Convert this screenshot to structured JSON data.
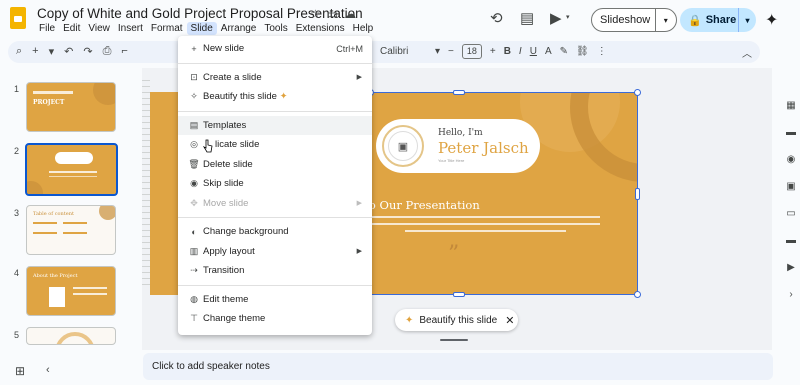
{
  "app": {
    "title": "Copy of White and Gold Project Proposal Presentation",
    "menus": [
      "File",
      "Edit",
      "View",
      "Insert",
      "Format",
      "Slide",
      "Arrange",
      "Tools",
      "Extensions",
      "Help"
    ],
    "active_menu": "Slide",
    "slideshow_label": "Slideshow",
    "share_label": "Share"
  },
  "toolbar": {
    "font": "Calibri",
    "font_size": "18"
  },
  "filmstrip": {
    "slides": [
      {
        "num": "1",
        "text": "PROJECT"
      },
      {
        "num": "2",
        "text": ""
      },
      {
        "num": "3",
        "text": "Table of content"
      },
      {
        "num": "4",
        "text": "About the Project"
      },
      {
        "num": "5",
        "text": ""
      }
    ]
  },
  "slide": {
    "hello": "Hello, I'm",
    "name": "Peter Jalsch",
    "subtitle": "Your Title Here",
    "welcome": "Welcome to Our Presentation",
    "quote_mark": "”"
  },
  "slide_menu": {
    "items": [
      {
        "label": "New slide",
        "shortcut": "Ctrl+M",
        "icon": "plus-icon"
      },
      {
        "label": "Create a slide",
        "submenu": true,
        "icon": "create-slide-icon"
      },
      {
        "label": "Beautify this slide",
        "icon": "beautify-icon"
      },
      {
        "label": "Templates",
        "icon": "templates-icon"
      },
      {
        "label": "Duplicate slide",
        "icon": "duplicate-icon"
      },
      {
        "label": "Delete slide",
        "icon": "delete-icon"
      },
      {
        "label": "Skip slide",
        "icon": "skip-icon"
      },
      {
        "label": "Move slide",
        "submenu": true,
        "disabled": true,
        "icon": "move-icon"
      },
      {
        "label": "Change background",
        "icon": "background-icon"
      },
      {
        "label": "Apply layout",
        "submenu": true,
        "icon": "layout-icon"
      },
      {
        "label": "Transition",
        "icon": "transition-icon"
      },
      {
        "label": "Edit theme",
        "icon": "edit-theme-icon"
      },
      {
        "label": "Change theme",
        "icon": "change-theme-icon"
      }
    ],
    "duplicate_visible": "licate slide"
  },
  "beautify_chip": {
    "label": "Beautify this slide"
  },
  "notes": {
    "placeholder": "Click to add speaker notes"
  },
  "colors": {
    "accent": "#0b57d0",
    "slide_gold": "#dfa443",
    "share_bg": "#c2e7ff"
  }
}
